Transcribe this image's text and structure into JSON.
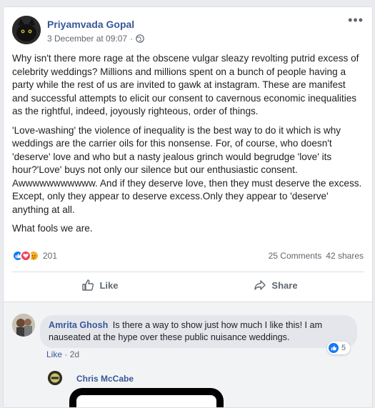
{
  "post": {
    "author": "Priyamvada Gopal",
    "timestamp": "3 December at 09:07",
    "separator": "·",
    "privacy_icon": "globe-icon",
    "more_icon": "more-options-icon",
    "paragraphs": [
      "Why isn't there more rage at the obscene vulgar sleazy revolting putrid excess of celebrity weddings? Millions and millions spent on a bunch of people having a party while the rest of us are invited to gawk at instagram. These are manifest and successful attempts to elicit our consent to cavernous economic inequalities as the rightful, indeed, joyously righteous, order of things.",
      "'Love-washing' the violence of inequality is the best way to do it which is why weddings are the carrier oils for this nonsense. For, of course, who doesn't 'deserve' love and who but a nasty jealous grinch would begrudge 'love' its hour?'Love' buys not only our silence but our enthusiastic consent. Awwwwwwwwwww. And if they deserve love, then they must deserve the excess. Except, only they appear to deserve excess.Only they appear to 'deserve' anything at all.",
      "What fools we are."
    ]
  },
  "stats": {
    "reactions": [
      "like-reaction-icon",
      "love-reaction-icon",
      "angry-reaction-icon"
    ],
    "reaction_count": "201",
    "comments": "25 Comments",
    "shares": "42 shares"
  },
  "actions": {
    "like_label": "Like",
    "share_label": "Share"
  },
  "comments": [
    {
      "author": "Amrita Ghosh",
      "text": "Is there a way to show just how much I like this! I am nauseated at the hype over these public nuisance weddings.",
      "reaction_count": "5",
      "like_label": "Like",
      "separator": "·",
      "age": "2d"
    }
  ],
  "reply": {
    "author": "Chris McCabe"
  },
  "colors": {
    "link": "#365899",
    "like_blue": "#1877f2",
    "love_red": "#f33e58",
    "angry_yellow": "#f7b125",
    "muted": "#606770"
  }
}
